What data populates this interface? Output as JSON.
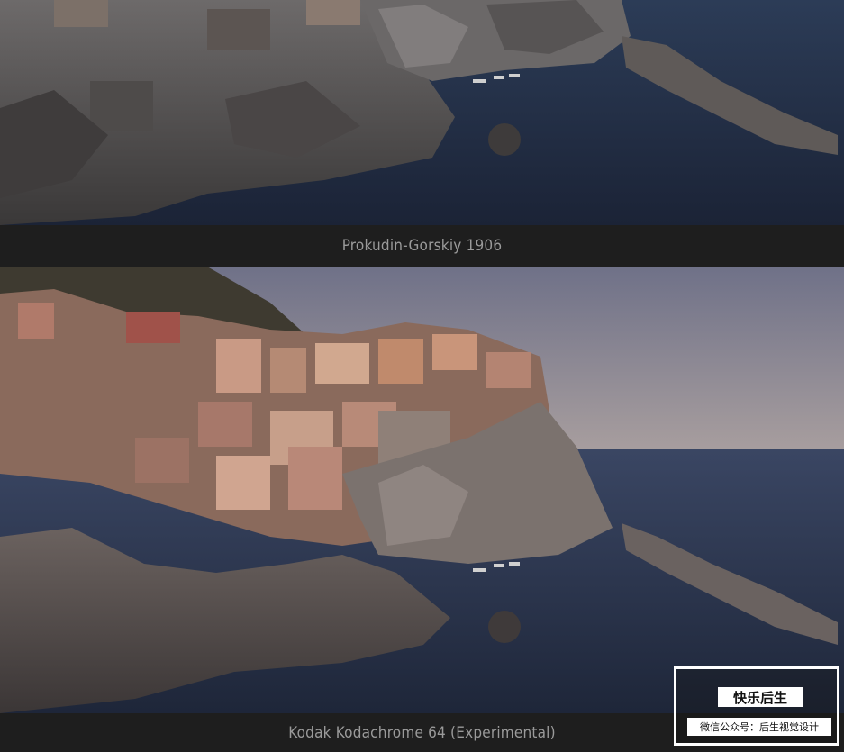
{
  "comparison": {
    "top_label": "Prokudin-Gorskiy 1906",
    "bottom_label": "Kodak Kodachrome 64 (Experimental)"
  },
  "watermark": {
    "title": "快乐后生",
    "subtitle": "微信公众号：后生视觉设计"
  },
  "colors": {
    "sea": "#22304a",
    "sky": "#8f8ea0",
    "rock": "#5a5656"
  }
}
